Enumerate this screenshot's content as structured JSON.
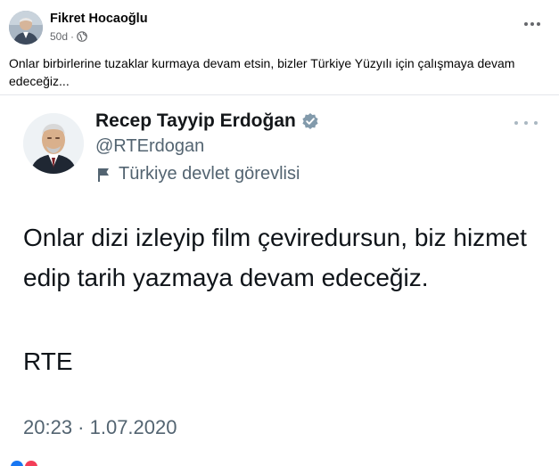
{
  "post": {
    "author": "Fikret Hocaoğlu",
    "time": "50d",
    "separator": "·",
    "privacy_icon": "globe-icon",
    "text": "Onlar birbirlerine tuzaklar kurmaya devam etsin, bizler Türkiye Yüzyılı için çalışmaya devam edeceğiz..."
  },
  "tweet": {
    "name": "Recep Tayyip Erdoğan",
    "handle": "@RTErdogan",
    "label": "Türkiye devlet görevlisi",
    "body": "Onlar dizi izleyip film çeviredursun, biz hizmet edip tarih yazmaya devam edeceğiz.",
    "signature": "RTE",
    "timestamp": "20:23 · 1.07.2020"
  },
  "colors": {
    "fb_text": "#050505",
    "fb_secondary": "#65676b",
    "tweet_text": "#0f1419",
    "tweet_secondary": "#536471",
    "badge": "#829aab"
  }
}
